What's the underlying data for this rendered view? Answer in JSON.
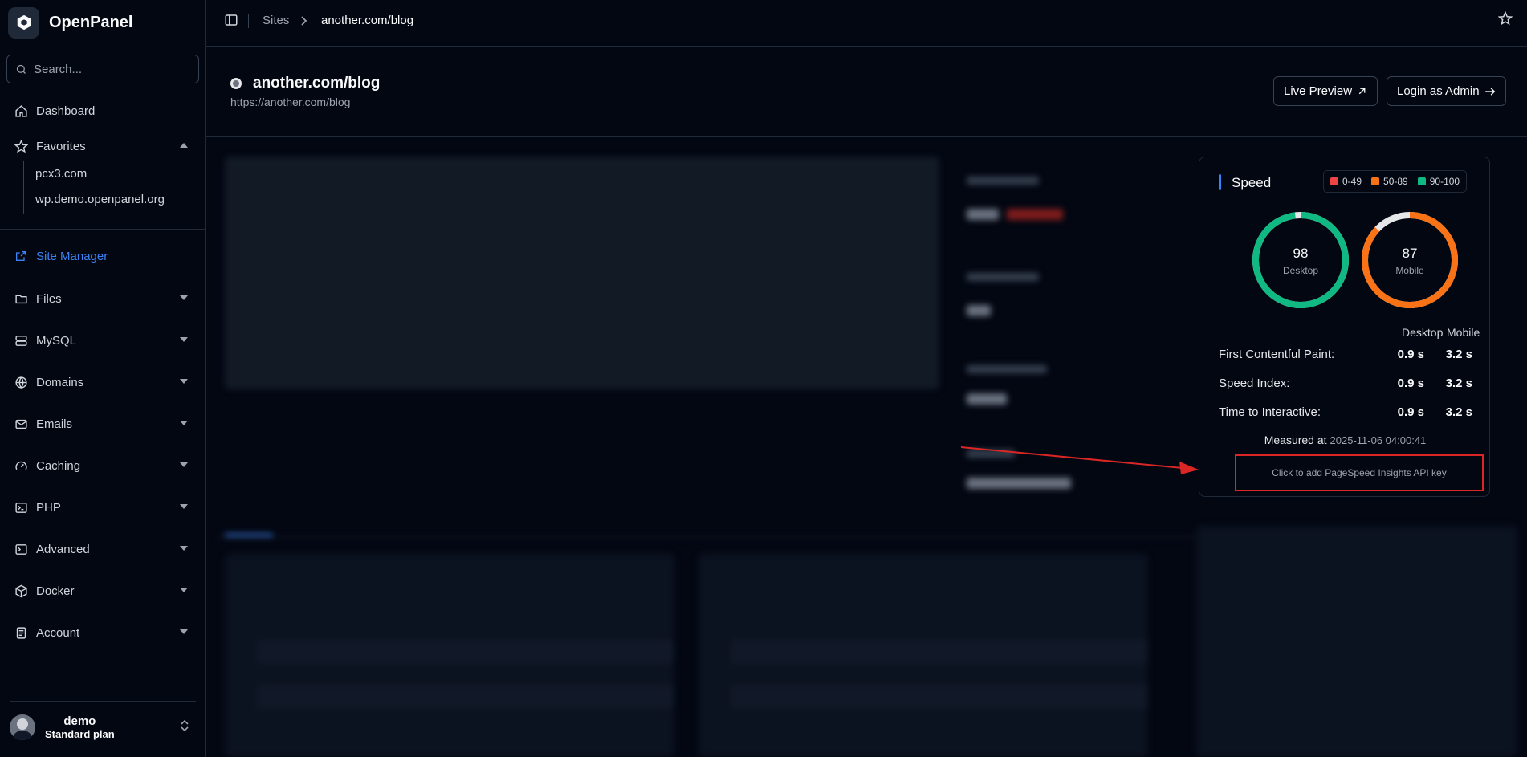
{
  "app": {
    "name": "OpenPanel"
  },
  "search": {
    "placeholder": "Search..."
  },
  "sidebar": {
    "dashboard": "Dashboard",
    "favorites": "Favorites",
    "favorite_items": [
      "pcx3.com",
      "wp.demo.openpanel.org"
    ],
    "site_manager": "Site Manager",
    "files": "Files",
    "mysql": "MySQL",
    "domains": "Domains",
    "emails": "Emails",
    "caching": "Caching",
    "php": "PHP",
    "advanced": "Advanced",
    "docker": "Docker",
    "account": "Account"
  },
  "user": {
    "name": "demo",
    "plan": "Standard plan"
  },
  "breadcrumb": {
    "root": "Sites",
    "current": "another.com/blog"
  },
  "site": {
    "title": "another.com/blog",
    "url": "https://another.com/blog"
  },
  "actions": {
    "live_preview": "Live Preview",
    "login_admin": "Login as Admin"
  },
  "speed": {
    "title": "Speed",
    "legend": [
      {
        "label": "0-49",
        "color": "#ef4444"
      },
      {
        "label": "50-89",
        "color": "#f97316"
      },
      {
        "label": "90-100",
        "color": "#10b981"
      }
    ],
    "desktop": {
      "score": "98",
      "label": "Desktop",
      "color": "#10b981",
      "fraction": 0.98
    },
    "mobile": {
      "score": "87",
      "label": "Mobile",
      "color": "#f97316",
      "fraction": 0.87
    },
    "col_desktop": "Desktop",
    "col_mobile": "Mobile",
    "metrics": [
      {
        "name": "First Contentful Paint:",
        "desktop": "0.9 s",
        "mobile": "3.2 s"
      },
      {
        "name": "Speed Index:",
        "desktop": "0.9 s",
        "mobile": "3.2 s"
      },
      {
        "name": "Time to Interactive:",
        "desktop": "0.9 s",
        "mobile": "3.2 s"
      }
    ],
    "measured_label": "Measured at",
    "measured_time": "2025-11-06 04:00:41",
    "api_key_button": "Click to add PageSpeed Insights API key"
  }
}
